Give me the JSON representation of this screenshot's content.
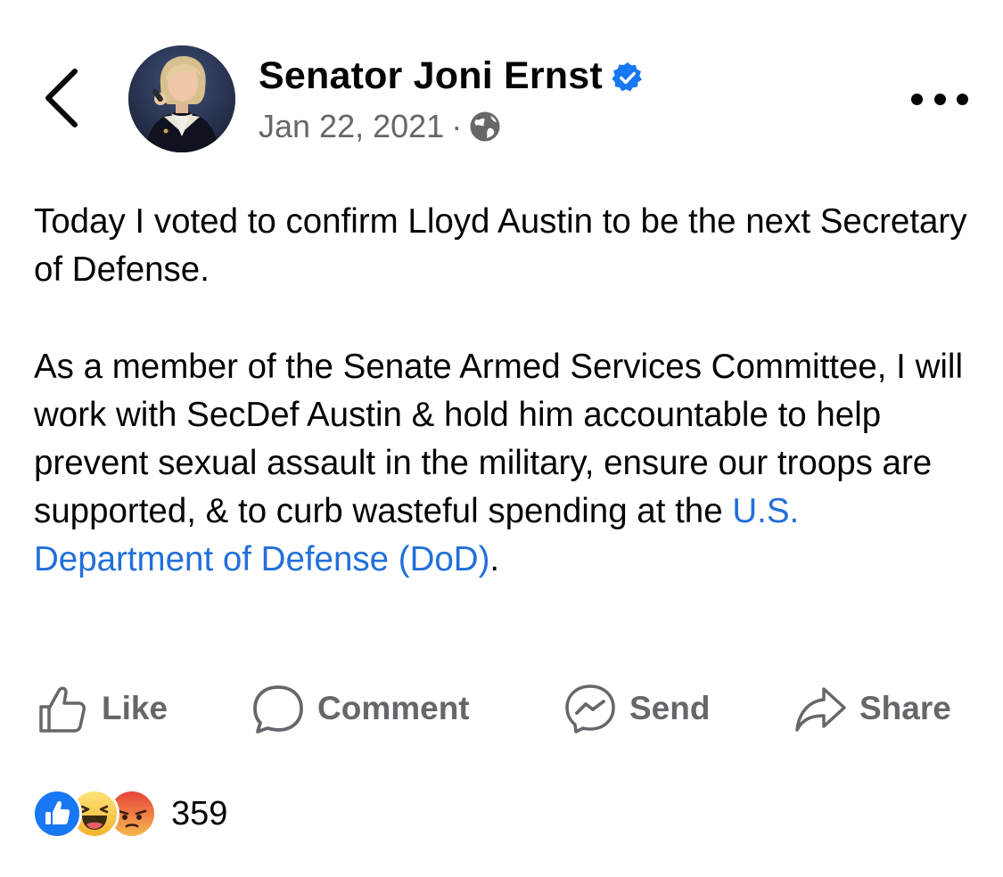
{
  "post": {
    "author": "Senator Joni Ernst",
    "date": "Jan 22, 2021",
    "separator": "·",
    "audience_icon": "globe-icon",
    "verified_icon": "verified-badge-icon",
    "paragraph1": "Today I voted to confirm Lloyd Austin to be the next Secretary of Defense.",
    "paragraph2_text": "As a member of the Senate Armed Services Committee, I will work with SecDef Austin & hold him accountable to help prevent sexual assault in the military, ensure our troops are supported, & to curb wasteful spending at the ",
    "paragraph2_link": "U.S. Department of Defense (DoD)",
    "paragraph2_end": "."
  },
  "actions": {
    "like": "Like",
    "comment": "Comment",
    "send": "Send",
    "share": "Share"
  },
  "reactions": {
    "count": "359",
    "types": [
      "like-reaction-icon",
      "haha-reaction-icon",
      "angry-reaction-icon"
    ]
  },
  "colors": {
    "link": "#216fdb",
    "secondary_text": "#65676b",
    "verified": "#1877f2",
    "like_blue": "#1877f2",
    "haha_yellow": "#f7c93c",
    "angry_orange": "#e9573a"
  }
}
